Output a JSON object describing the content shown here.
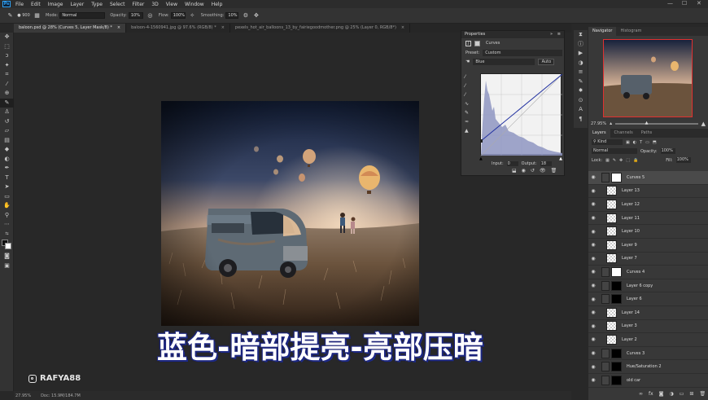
{
  "menu": {
    "logo": "Ps",
    "items": [
      "File",
      "Edit",
      "Image",
      "Layer",
      "Type",
      "Select",
      "Filter",
      "3D",
      "View",
      "Window",
      "Help"
    ]
  },
  "options": {
    "brush_size": "900",
    "mode_label": "Mode:",
    "mode_value": "Normal",
    "opacity_label": "Opacity:",
    "opacity_value": "10%",
    "flow_label": "Flow:",
    "flow_value": "100%",
    "smoothing_label": "Smoothing:",
    "smoothing_value": "10%"
  },
  "tabs": [
    {
      "label": "baloon.psd @ 28% (Curves 5, Layer Mask/8) *",
      "active": true
    },
    {
      "label": "baloon-4-1560941.jpg @ 97.6% (RGB/8) *",
      "active": false
    },
    {
      "label": "pexels_hot_air_balloons_13_by_fairiegoodmother.png @ 25% (Layer 0, RGB/8*)",
      "active": false
    }
  ],
  "status": {
    "zoom": "27.95%",
    "doc": "Doc: 15.9M/184.7M"
  },
  "properties": {
    "title": "Properties",
    "adjustment": "Curves",
    "preset_label": "Preset:",
    "preset_value": "Custom",
    "channel_value": "Blue",
    "auto_label": "Auto",
    "input_label": "Input:",
    "input_value": "0",
    "output_label": "Output:",
    "output_value": "18"
  },
  "navigator": {
    "tab1": "Navigator",
    "tab2": "Histogram",
    "zoom": "27.95%"
  },
  "layers_panel": {
    "tabs": [
      "Layers",
      "Channels",
      "Paths"
    ],
    "kind_label": "Kind",
    "blend_mode": "Normal",
    "opacity_label": "Opacity:",
    "opacity_value": "100%",
    "lock_label": "Lock:",
    "fill_label": "Fill:",
    "fill_value": "100%",
    "layers": [
      {
        "name": "Curves 5",
        "type": "adjust"
      },
      {
        "name": "Layer 13",
        "type": "pixel"
      },
      {
        "name": "Layer 12",
        "type": "pixel"
      },
      {
        "name": "Layer 11",
        "type": "pixel"
      },
      {
        "name": "Layer 10",
        "type": "pixel"
      },
      {
        "name": "Layer 9",
        "type": "pixel"
      },
      {
        "name": "Layer 7",
        "type": "pixel"
      },
      {
        "name": "Curves 4",
        "type": "adjust"
      },
      {
        "name": "Layer 6 copy",
        "type": "masked"
      },
      {
        "name": "Layer 6",
        "type": "masked"
      },
      {
        "name": "Layer 14",
        "type": "pixel"
      },
      {
        "name": "Layer 3",
        "type": "pixel"
      },
      {
        "name": "Layer 2",
        "type": "pixel"
      },
      {
        "name": "Curves 3",
        "type": "masked"
      },
      {
        "name": "Hue/Saturation 2",
        "type": "masked"
      },
      {
        "name": "old car",
        "type": "masked"
      }
    ]
  },
  "caption": "蓝色-暗部提亮-亮部压暗",
  "watermark": "RAFYA88",
  "colors": {
    "accent": "#2fa3f7",
    "caption_outline": "#1d2c8c",
    "nav_frame": "#e03030"
  }
}
